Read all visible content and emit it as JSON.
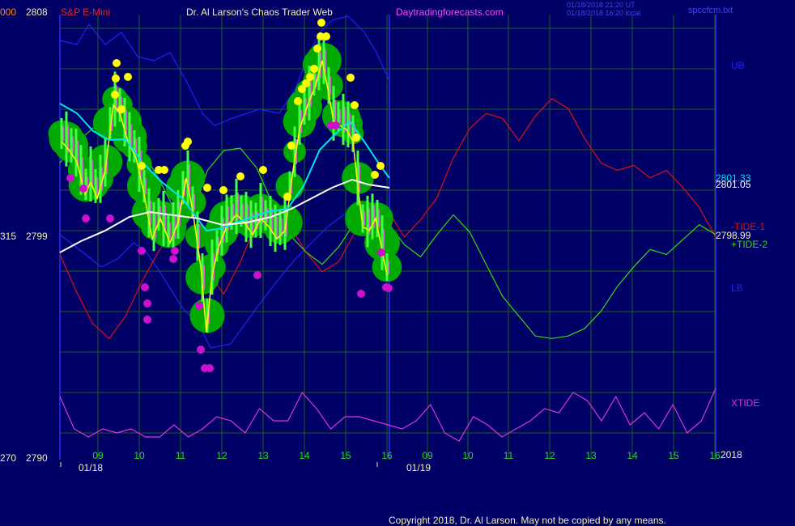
{
  "header": {
    "left_scale_top": "000",
    "price_top": "2808",
    "instrument": "S&P E-Mini",
    "site_title": "Dr. Al Larson's Chaos Trader Web",
    "site_url": "Daytradingforecasts.com",
    "timestamp_line1": "01/18/2018 21:20 UT",
    "timestamp_line2": "01/18/2018 16:20 local",
    "file_name": "spccfcm.txt"
  },
  "left_axis": {
    "mid_scale": "315",
    "mid_price": "2799",
    "bottom_scale": "270",
    "bottom_price": "2790"
  },
  "right_labels": {
    "ub": "UB",
    "val_upper1": "2801.33",
    "val_upper2": "2801.05",
    "tide1": "-TIDE-1",
    "last_price": "2798.99",
    "tide2": "+TIDE-2",
    "lb": "LB",
    "xtide": "XTIDE",
    "year": "2018"
  },
  "dates": {
    "day1": "01/18",
    "day2": "01/19"
  },
  "footer": {
    "copyright": "Copyright 2018, Dr. Al Larson. May not be copied by any means."
  },
  "colors": {
    "background": "#000066",
    "grid": "#1f5f1f",
    "divider": "#2a2aff",
    "hour_label": "#22dd22",
    "price_text": "#f0f0b0",
    "price_bar": "#ff55ff",
    "dot_high": "#ffff00",
    "dot_low": "#cc11cc",
    "halo": "#00aa00",
    "ma_fast": "#ffff00",
    "ma_mid": "#00e5ee",
    "ma_slow": "#ffffff",
    "tide1": "#dd1111",
    "tide2": "#33dd11",
    "bands": "#2222ee",
    "xtide": "#dd33dd"
  },
  "chart_data": {
    "type": "line",
    "x_hour_ticks": [
      "09",
      "10",
      "11",
      "12",
      "13",
      "14",
      "15",
      "16",
      "09",
      "10",
      "11",
      "12",
      "13",
      "14",
      "15",
      "16"
    ],
    "y_price_labels": [
      "2808",
      "2799",
      "2790"
    ],
    "series": [
      {
        "name": "TIDE-1",
        "values": [
          2798.3,
          2796.8,
          2795.5,
          2794.9,
          2795.8,
          2797.2,
          2798.4,
          2799.3,
          2799.0,
          2797.6,
          2796.7,
          2798.0,
          2799.6,
          2800.3,
          2799.5,
          2798.4,
          2797.6,
          2798.0,
          2799.2,
          2800.1,
          2800.1,
          2799.0,
          2799.7,
          2800.6,
          2802.2,
          2803.4,
          2804.0,
          2803.8,
          2802.9,
          2803.9,
          2804.6,
          2804.2,
          2803.0,
          2802.0,
          2801.7,
          2801.9,
          2801.4,
          2801.7,
          2801.0,
          2800.2,
          2799.0
        ]
      },
      {
        "name": "TIDE-2",
        "values": [
          2802.0,
          2802.8,
          2803.4,
          2803.6,
          2803.3,
          2802.5,
          2801.4,
          2800.1,
          2799.8,
          2801.7,
          2802.5,
          2802.6,
          2801.8,
          2800.3,
          2799.1,
          2798.4,
          2797.9,
          2798.6,
          2799.6,
          2800.0,
          2799.6,
          2798.7,
          2798.2,
          2799.1,
          2799.9,
          2799.2,
          2797.9,
          2796.6,
          2795.8,
          2795.0,
          2794.9,
          2795.0,
          2795.3,
          2796.0,
          2797.0,
          2797.8,
          2798.5,
          2798.3,
          2798.9,
          2799.5,
          2799.1
        ]
      },
      {
        "name": "XTIDE",
        "values": [
          0.7,
          0.3,
          0.2,
          0.3,
          0.25,
          0.3,
          0.2,
          0.2,
          0.35,
          0.2,
          0.3,
          0.45,
          0.4,
          0.25,
          0.55,
          0.4,
          0.4,
          0.75,
          0.55,
          0.3,
          0.45,
          0.45,
          0.4,
          0.35,
          0.3,
          0.4,
          0.6,
          0.25,
          0.15,
          0.45,
          0.35,
          0.2,
          0.3,
          0.4,
          0.55,
          0.5,
          0.75,
          0.65,
          0.4,
          0.7,
          0.35,
          0.5,
          0.3,
          0.6,
          0.25,
          0.4,
          0.8
        ]
      }
    ]
  }
}
